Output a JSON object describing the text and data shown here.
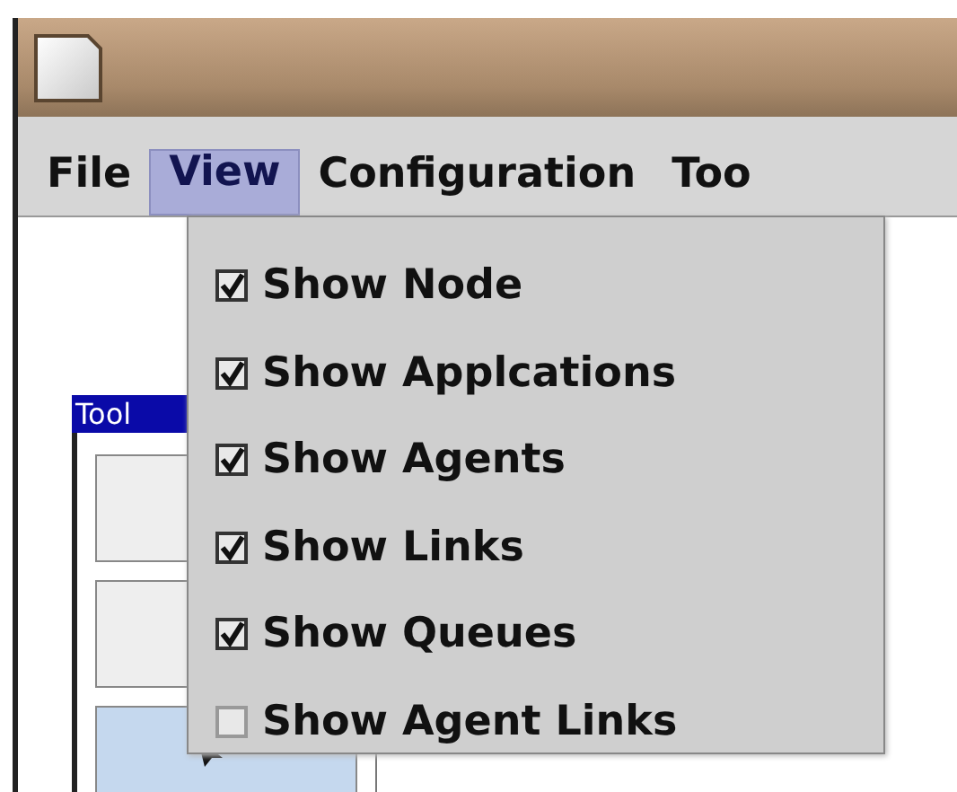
{
  "menu_bar": [
    {
      "label": "File",
      "selected": false
    },
    {
      "label": "View",
      "selected": true
    },
    {
      "label": "Configuration",
      "selected": false
    },
    {
      "label": "Too",
      "selected": false
    }
  ],
  "view_menu": [
    {
      "label": "Show Node",
      "checked": true
    },
    {
      "label": "Show Applcations",
      "checked": true
    },
    {
      "label": "Show Agents",
      "checked": true
    },
    {
      "label": "Show Links",
      "checked": true
    },
    {
      "label": "Show Queues",
      "checked": true
    },
    {
      "label": "Show Agent Links",
      "checked": false
    }
  ],
  "tool_palette": {
    "title": "Tool",
    "buttons": [
      {
        "selected": false
      },
      {
        "selected": false
      },
      {
        "selected": true
      }
    ]
  }
}
